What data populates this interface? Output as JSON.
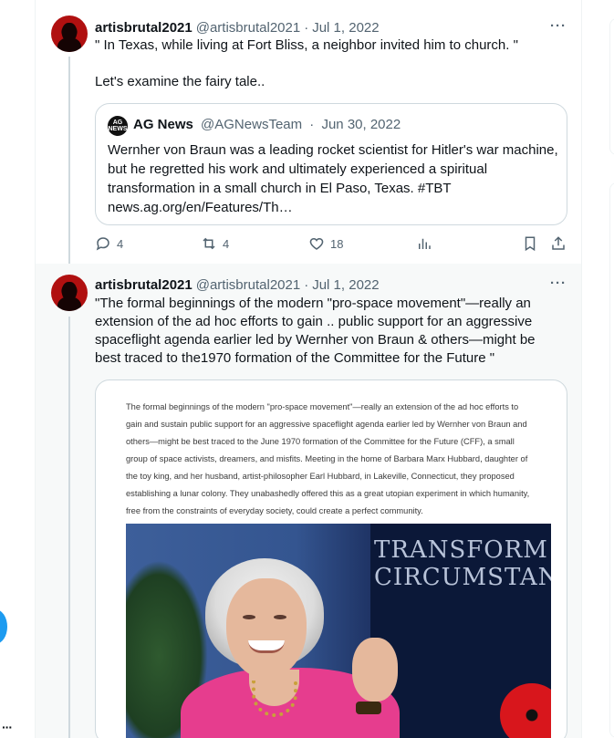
{
  "tweet1": {
    "name": "artisbrutal2021",
    "handle": "@artisbrutal2021",
    "separator": "·",
    "date": "Jul 1, 2022",
    "more": "···",
    "text": "\" In Texas, while living at Fort Bliss, a neighbor invited him to church. \"\n\nLet's examine the fairy tale..",
    "quote": {
      "avatar_text": "AG NEWS",
      "name": "AG News",
      "handle": "@AGNewsTeam",
      "separator": "·",
      "date": "Jun 30, 2022",
      "text": "Wernher von Braun was a leading rocket scientist for Hitler's war machine, but he regretted his work and ultimately experienced a spiritual transformation in a small church in El Paso, Texas. #TBT news.ag.org/en/Features/Th…"
    },
    "actions": {
      "replies": "4",
      "retweets": "4",
      "likes": "18"
    }
  },
  "tweet2": {
    "name": "artisbrutal2021",
    "handle": "@artisbrutal2021",
    "separator": "·",
    "date": "Jul 1, 2022",
    "more": "···",
    "text": "\"The formal beginnings of the modern \"pro-space movement\"—really an extension of the ad hoc efforts to gain .. public support for an aggressive spaceflight agenda earlier led by Wernher von Braun & others—might be best traced to the1970 formation of the Committee for the Future \"",
    "media": {
      "excerpt": "The formal beginnings of the modern \"pro-space movement\"—really an extension of the ad hoc efforts to gain and sustain public support for an aggressive spaceflight agenda earlier led by Wernher von Braun and others—might be best traced to the June 1970 formation of the Committee for the Future (CFF), a small group of space activists, dreamers, and misfits. Meeting in the home of Barbara Marx Hubbard, daughter of the toy king, and her husband, artist-philosopher Earl Hubbard, in Lakeville, Connecticut, they proposed establishing a lunar colony. They unabashedly offered this as a great utopian experiment in which humanity, free from the constraints of everyday society, could create a perfect community.",
      "banner_line1": "TRANSFORM",
      "banner_line2": "CIRCUMSTAN"
    }
  },
  "left_rail": {
    "more": "···"
  },
  "colors": {
    "accent": "#1d9bf0",
    "text_primary": "#0f1419",
    "text_secondary": "#536471",
    "border": "#cfd9de",
    "highlight_bg": "#f7f9f9"
  },
  "icons": [
    "reply-icon",
    "retweet-icon",
    "like-icon",
    "views-icon",
    "bookmark-icon",
    "share-icon",
    "more-icon"
  ]
}
